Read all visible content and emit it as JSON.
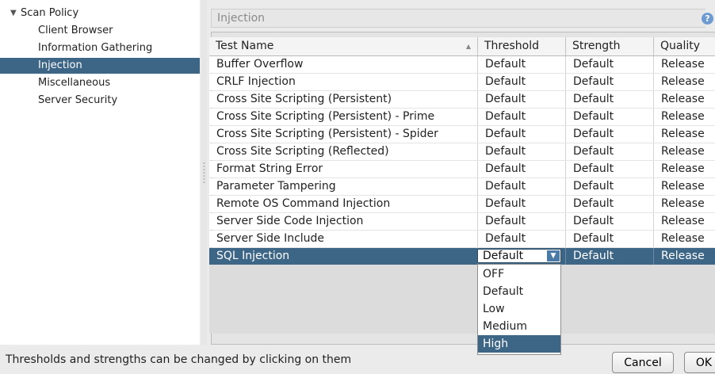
{
  "tree": {
    "toggle": "▼",
    "root": "Scan Policy",
    "children": [
      "Client Browser",
      "Information Gathering",
      "Injection",
      "Miscellaneous",
      "Server Security"
    ],
    "selected": "Injection"
  },
  "panel": {
    "title": "Injection",
    "help_icon": "?"
  },
  "table": {
    "columns": [
      "Test Name",
      "Threshold",
      "Strength",
      "Quality"
    ],
    "sort_indicator": "▲",
    "rows": [
      {
        "name": "Buffer Overflow",
        "threshold": "Default",
        "strength": "Default",
        "quality": "Release"
      },
      {
        "name": "CRLF Injection",
        "threshold": "Default",
        "strength": "Default",
        "quality": "Release"
      },
      {
        "name": "Cross Site Scripting (Persistent)",
        "threshold": "Default",
        "strength": "Default",
        "quality": "Release"
      },
      {
        "name": "Cross Site Scripting (Persistent) - Prime",
        "threshold": "Default",
        "strength": "Default",
        "quality": "Release"
      },
      {
        "name": "Cross Site Scripting (Persistent) - Spider",
        "threshold": "Default",
        "strength": "Default",
        "quality": "Release"
      },
      {
        "name": "Cross Site Scripting (Reflected)",
        "threshold": "Default",
        "strength": "Default",
        "quality": "Release"
      },
      {
        "name": "Format String Error",
        "threshold": "Default",
        "strength": "Default",
        "quality": "Release"
      },
      {
        "name": "Parameter Tampering",
        "threshold": "Default",
        "strength": "Default",
        "quality": "Release"
      },
      {
        "name": "Remote OS Command Injection",
        "threshold": "Default",
        "strength": "Default",
        "quality": "Release"
      },
      {
        "name": "Server Side Code Injection",
        "threshold": "Default",
        "strength": "Default",
        "quality": "Release"
      },
      {
        "name": "Server Side Include",
        "threshold": "Default",
        "strength": "Default",
        "quality": "Release"
      },
      {
        "name": "SQL Injection",
        "threshold": "Default",
        "strength": "Default",
        "quality": "Release"
      }
    ],
    "selected_row": "SQL Injection"
  },
  "threshold_combo": {
    "value": "Default",
    "arrow": "▼",
    "options": [
      "OFF",
      "Default",
      "Low",
      "Medium",
      "High"
    ],
    "highlighted": "High"
  },
  "footer": {
    "status": "Thresholds and strengths can be changed by clicking on them",
    "cancel_label": "Cancel",
    "ok_label": "OK"
  },
  "colors": {
    "selection": "#3d6585",
    "combo_button": "#4c7aa6"
  }
}
